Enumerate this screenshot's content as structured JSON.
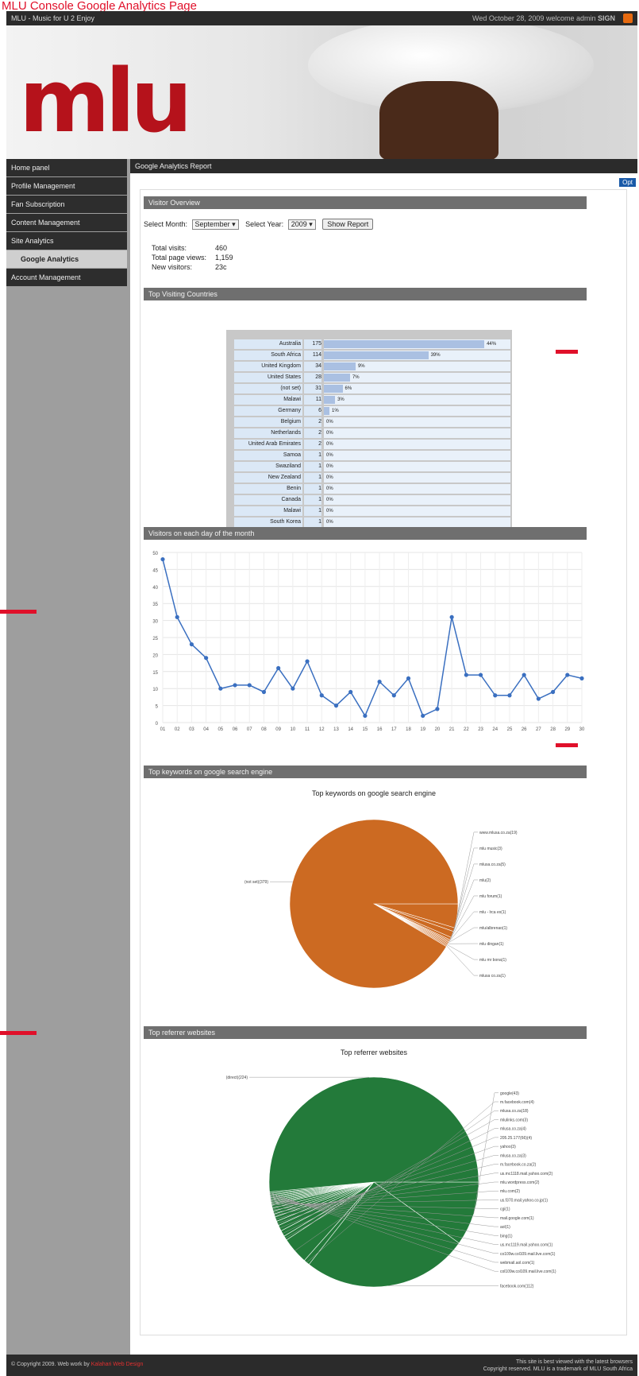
{
  "caption": "MLU Console Google Analytics Page",
  "topbar": {
    "title": "MLU - Music for U 2 Enjoy",
    "right": "Wed October 28, 2009 welcome admin",
    "right_link": "SIGN"
  },
  "banner": {
    "logo": "mlu"
  },
  "nav": [
    "Home panel",
    "Profile Management",
    "Fan Subscription",
    "Content Management",
    "Site Analytics",
    "Google Analytics",
    "Account Management"
  ],
  "main": {
    "header": "Google Analytics Report",
    "options": "Opt",
    "visitor_overview": "Visitor Overview",
    "select_month_label": "Select Month:",
    "month": "September",
    "select_year_label": "Select Year:",
    "year": "2009",
    "show_report": "Show Report",
    "stats": [
      {
        "label": "Total visits:",
        "value": "460"
      },
      {
        "label": "Total page views:",
        "value": "1,159"
      },
      {
        "label": "New visitors:",
        "value": "23c"
      }
    ],
    "top_countries_title": "Top Visiting Countries",
    "visitors_day_title": "Visitors on each day of the month",
    "keywords_title": "Top keywords on google search engine",
    "keywords_chart_title": "Top keywords on google search engine",
    "referrers_title": "Top referrer websites",
    "referrers_chart_title": "Top referrer websites"
  },
  "countries": [
    {
      "name": "Australia",
      "count": 175,
      "pct": "44%",
      "frac": 0.86
    },
    {
      "name": "South Africa",
      "count": 114,
      "pct": "39%",
      "frac": 0.56
    },
    {
      "name": "United Kingdom",
      "count": 34,
      "pct": "9%",
      "frac": 0.17
    },
    {
      "name": "United States",
      "count": 28,
      "pct": "7%",
      "frac": 0.14
    },
    {
      "name": "(not set)",
      "count": 31,
      "pct": "6%",
      "frac": 0.1
    },
    {
      "name": "Malawi",
      "count": 11,
      "pct": "3%",
      "frac": 0.06
    },
    {
      "name": "Germany",
      "count": 6,
      "pct": "1%",
      "frac": 0.03
    },
    {
      "name": "Belgium",
      "count": 2,
      "pct": "0%",
      "frac": 0
    },
    {
      "name": "Netherlands",
      "count": 2,
      "pct": "0%",
      "frac": 0
    },
    {
      "name": "United Arab Emirates",
      "count": 2,
      "pct": "0%",
      "frac": 0
    },
    {
      "name": "Samoa",
      "count": 1,
      "pct": "0%",
      "frac": 0
    },
    {
      "name": "Swaziland",
      "count": 1,
      "pct": "0%",
      "frac": 0
    },
    {
      "name": "New Zealand",
      "count": 1,
      "pct": "0%",
      "frac": 0
    },
    {
      "name": "Benin",
      "count": 1,
      "pct": "0%",
      "frac": 0
    },
    {
      "name": "Canada",
      "count": 1,
      "pct": "0%",
      "frac": 0
    },
    {
      "name": "Malawi",
      "count": 1,
      "pct": "0%",
      "frac": 0
    },
    {
      "name": "South Korea",
      "count": 1,
      "pct": "0%",
      "frac": 0
    }
  ],
  "chart_data": [
    {
      "type": "line",
      "title": "",
      "x": [
        "01",
        "02",
        "03",
        "04",
        "05",
        "06",
        "07",
        "08",
        "09",
        "10",
        "11",
        "12",
        "13",
        "14",
        "15",
        "16",
        "17",
        "18",
        "19",
        "20",
        "21",
        "22",
        "23",
        "24",
        "25",
        "26",
        "27",
        "28",
        "29",
        "30"
      ],
      "series": [
        {
          "values": [
            48,
            31,
            23,
            19,
            10,
            11,
            11,
            9,
            16,
            10,
            18,
            8,
            5,
            9,
            2,
            12,
            8,
            13,
            2,
            4,
            31,
            14,
            14,
            8,
            8,
            14,
            7,
            9,
            14,
            13
          ]
        }
      ],
      "yticks": [
        0,
        5,
        10,
        15,
        20,
        25,
        30,
        35,
        40,
        45,
        50
      ],
      "ylim": [
        0,
        50
      ],
      "color": "#3a6fc0"
    },
    {
      "type": "pie",
      "title": "Top keywords on google search engine",
      "color": "#cc6a22",
      "labels": [
        "www.mlusa.co.za(19)",
        "mlu music(3)",
        "mlusa.co.za(5)",
        "mlu(2)",
        "mlu forum(1)",
        "mlu - lrca ex(1)",
        "mlu/albrenao(1)",
        "mlu dingan(1)",
        "mlu mr bona(1)",
        "mlusa co.za(1)",
        "(not set)(379)"
      ],
      "values": [
        19,
        3,
        5,
        2,
        1,
        1,
        1,
        1,
        1,
        1,
        379
      ]
    },
    {
      "type": "pie",
      "title": "Top referrer websites",
      "color": "#237a3a",
      "labels": [
        "google(43)",
        "facebook.com(112)",
        "m.facebook.com(4)",
        "mlusa.co.za(18)",
        "mlulinks.com(3)",
        "mlusa.co.za(4)",
        "205.25.177(66)(4)",
        "yahoo(3)",
        "mlusa.co.za(3)",
        "m.facebook.co.za(2)",
        "us.mc1118.mail.yahoo.com(2)",
        "mlu.wordpress.com(2)",
        "mlu.com(2)",
        "us.f370.mail.yahoo.co.jp(1)",
        "cgi(1)",
        "mail.google.com(1)",
        "aol(1)",
        "bing(1)",
        "us.mc1119.mail.yahoo.com(1)",
        "co109w.col109.mail.live.com(1)",
        "webmail.aol.com(1)",
        "col109w.col109.mail.live.com(1)",
        "(direct)(224)"
      ],
      "values": [
        43,
        112,
        4,
        18,
        3,
        4,
        4,
        3,
        3,
        2,
        2,
        2,
        2,
        1,
        1,
        1,
        1,
        1,
        1,
        1,
        1,
        1,
        224
      ]
    }
  ],
  "footer": {
    "left": "© Copyright 2009. Web work by",
    "left_link": "Kalahari Web Design",
    "right1": "This site is best viewed with the latest browsers",
    "right2": "Copyright reserved. MLU is a trademark of MLU South Africa"
  }
}
